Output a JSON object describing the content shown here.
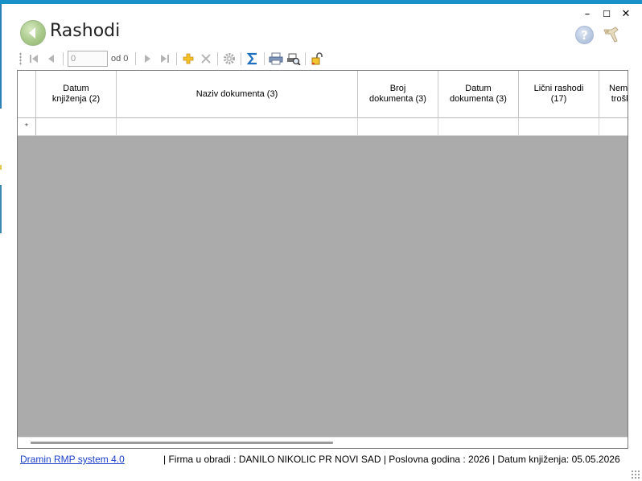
{
  "window": {
    "title": "Rashodi",
    "minimize_glyph": "–",
    "maximize_glyph": "☐",
    "close_glyph": "✕"
  },
  "header": {
    "help_glyph": "?"
  },
  "toolbar": {
    "position_value": "0",
    "of_label": "od 0"
  },
  "grid": {
    "columns": [
      {
        "label": "Datum\nknjiženja (2)"
      },
      {
        "label": "Naziv dokumenta (3)"
      },
      {
        "label": "Broj\ndokumenta (3)"
      },
      {
        "label": "Datum\ndokumenta (3)"
      },
      {
        "label": "Lični rashodi\n(17)"
      },
      {
        "label": "Nema\ntrošk"
      }
    ],
    "new_row_marker": "*"
  },
  "status": {
    "app_link": "Dramin RMP system 4.0",
    "info": "| Firma u obradi : DANILO NIKOLIC PR NOVI SAD  |  Poslovna godina : 2026  |  Datum knjiženja: 05.05.2026"
  },
  "colors": {
    "accent": "#1890c8",
    "grid_background": "#ababab",
    "link": "#1a3fc9"
  }
}
